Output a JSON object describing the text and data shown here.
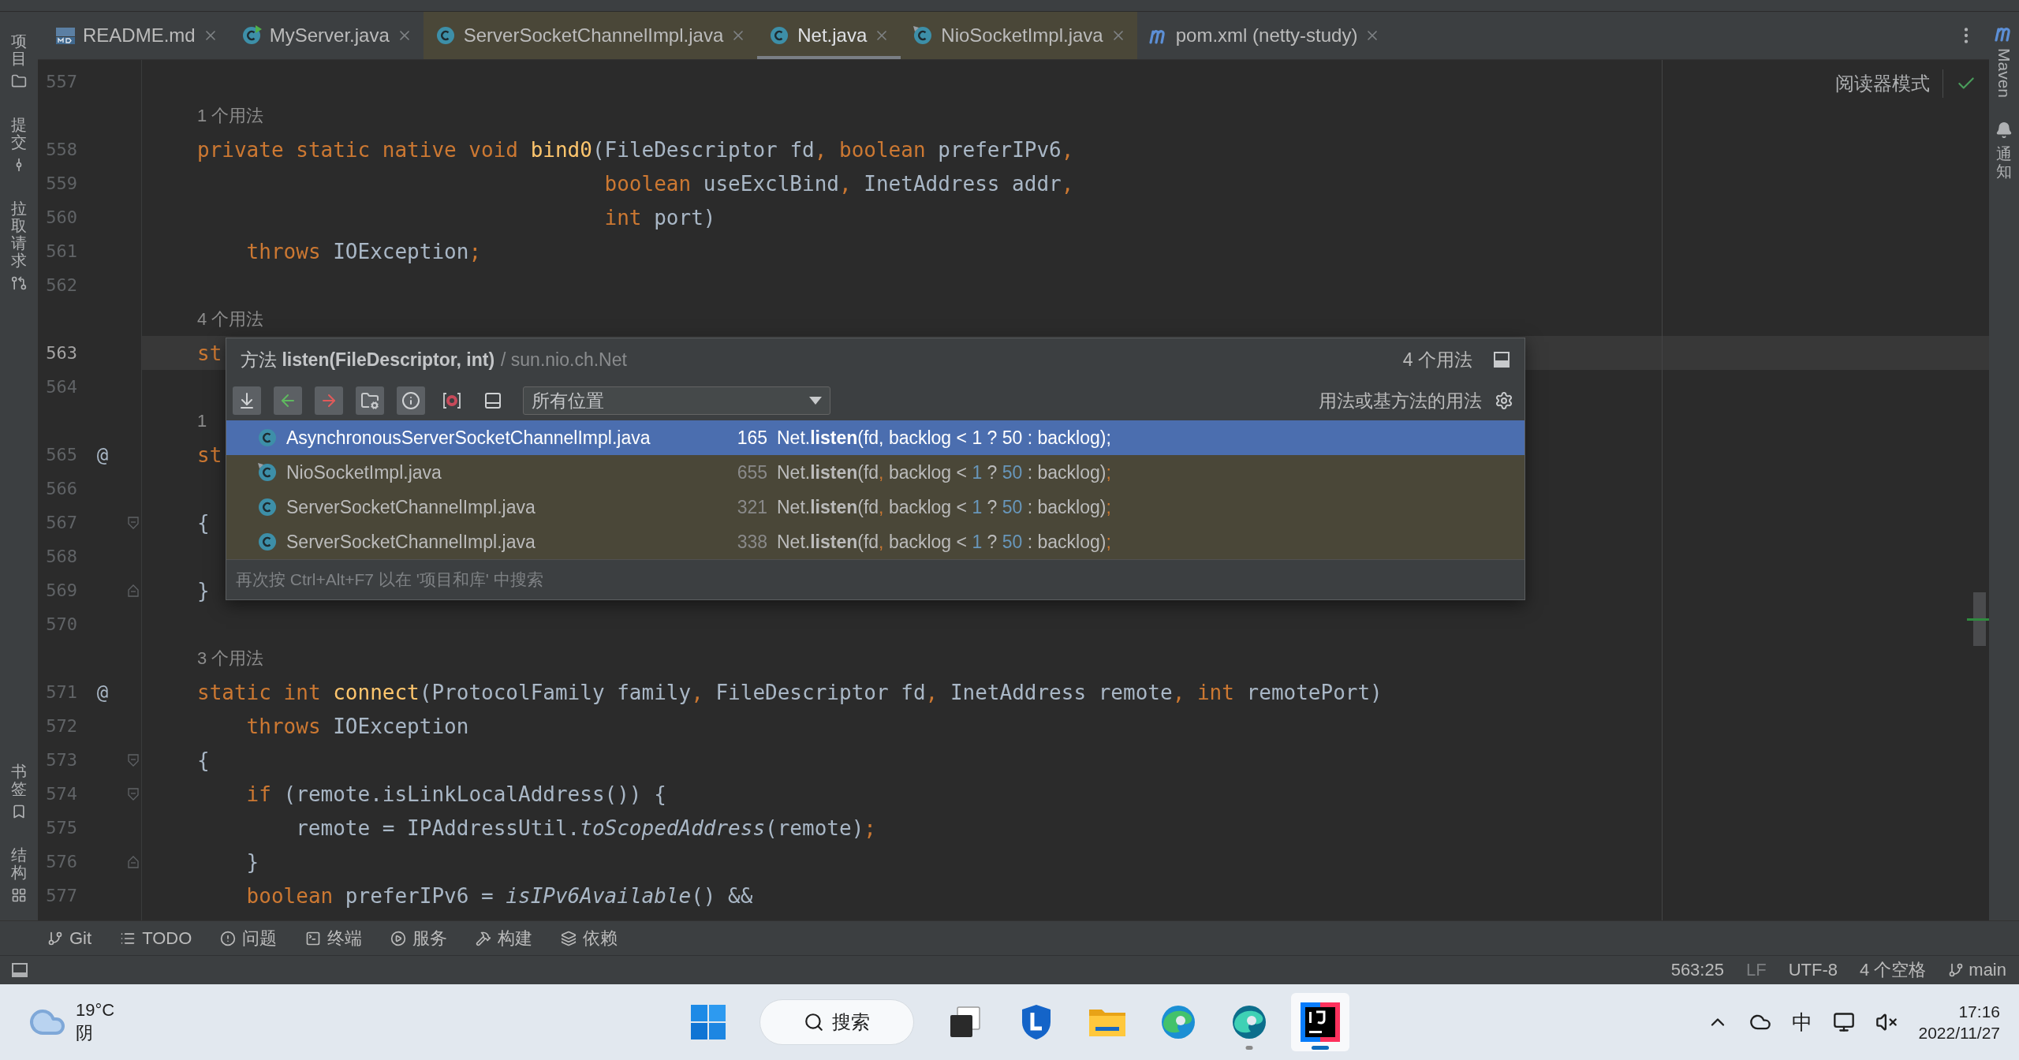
{
  "left_strip": {
    "top": [
      {
        "label": "项目",
        "kind": "folder"
      },
      {
        "label": "提交",
        "kind": "commit"
      },
      {
        "label": "拉取请求",
        "kind": "pull-request"
      }
    ],
    "bottom": [
      {
        "label": "书签",
        "kind": "bookmark"
      },
      {
        "label": "结构",
        "kind": "structure"
      }
    ]
  },
  "tabs": [
    {
      "label": "README.md",
      "kind": "markdown",
      "selected": false,
      "library": false
    },
    {
      "label": "MyServer.java",
      "kind": "class-run",
      "selected": false,
      "library": false
    },
    {
      "label": "ServerSocketChannelImpl.java",
      "kind": "class",
      "selected": false,
      "library": true
    },
    {
      "label": "Net.java",
      "kind": "class",
      "selected": true,
      "library": true
    },
    {
      "label": "NioSocketImpl.java",
      "kind": "class-pinned",
      "selected": false,
      "library": true
    },
    {
      "label": "pom.xml (netty-study)",
      "kind": "maven",
      "selected": false,
      "library": false
    }
  ],
  "editor": {
    "reader_mode": "阅读器模式",
    "lines": [
      {
        "kind": "code",
        "number": "557",
        "current": false
      },
      {
        "kind": "hint",
        "text": "1 个用法"
      },
      {
        "kind": "code",
        "number": "558",
        "current": false,
        "indent": {
          "kind": "none"
        },
        "tokens": [
          {
            "kind": "kw",
            "text": "private static native void "
          },
          {
            "kind": "method",
            "text": "bind0"
          },
          {
            "kind": "plain",
            "text": "(FileDescriptor fd"
          },
          {
            "kind": "punct",
            "text": ", "
          },
          {
            "kind": "kw",
            "text": "boolean "
          },
          {
            "kind": "plain",
            "text": "preferIPv6"
          },
          {
            "kind": "punct",
            "text": ","
          }
        ]
      },
      {
        "kind": "code",
        "number": "559",
        "current": false,
        "indent": {
          "kind": "args"
        },
        "tokens": [
          {
            "kind": "kw",
            "text": "boolean "
          },
          {
            "kind": "plain",
            "text": "useExclBind"
          },
          {
            "kind": "punct",
            "text": ", "
          },
          {
            "kind": "plain",
            "text": "InetAddress addr"
          },
          {
            "kind": "punct",
            "text": ","
          }
        ]
      },
      {
        "kind": "code",
        "number": "560",
        "current": false,
        "indent": {
          "kind": "args"
        },
        "tokens": [
          {
            "kind": "kw",
            "text": "int "
          },
          {
            "kind": "plain",
            "text": "port)"
          }
        ]
      },
      {
        "kind": "code",
        "number": "561",
        "current": false,
        "indent": {
          "kind": "one"
        },
        "tokens": [
          {
            "kind": "kw",
            "text": "throws "
          },
          {
            "kind": "plain",
            "text": "IOException"
          },
          {
            "kind": "punct",
            "text": ";"
          }
        ]
      },
      {
        "kind": "code",
        "number": "562",
        "current": false
      },
      {
        "kind": "hint",
        "text": "4 个用法"
      },
      {
        "kind": "code",
        "number": "563",
        "current": true,
        "indent": {
          "kind": "none"
        },
        "tokens": [
          {
            "kind": "kw",
            "text": "st"
          }
        ]
      },
      {
        "kind": "code",
        "number": "564",
        "current": false
      },
      {
        "kind": "hint",
        "text": "1"
      },
      {
        "kind": "code",
        "number": "565",
        "current": false,
        "marker": "@",
        "indent": {
          "kind": "none"
        },
        "tokens": [
          {
            "kind": "kw",
            "text": "st"
          }
        ]
      },
      {
        "kind": "code",
        "number": "566",
        "current": false
      },
      {
        "kind": "code",
        "number": "567",
        "current": false,
        "fold": {
          "kind": "start"
        },
        "indent": {
          "kind": "none"
        },
        "tokens": [
          {
            "kind": "plain",
            "text": "{"
          }
        ]
      },
      {
        "kind": "code",
        "number": "568",
        "current": false
      },
      {
        "kind": "code",
        "number": "569",
        "current": false,
        "fold": {
          "kind": "end"
        },
        "indent": {
          "kind": "none"
        },
        "tokens": [
          {
            "kind": "plain",
            "text": "}"
          }
        ]
      },
      {
        "kind": "code",
        "number": "570",
        "current": false
      },
      {
        "kind": "hint",
        "text": "3 个用法"
      },
      {
        "kind": "code",
        "number": "571",
        "current": false,
        "marker": "@",
        "indent": {
          "kind": "none"
        },
        "tokens": [
          {
            "kind": "kw",
            "text": "static int "
          },
          {
            "kind": "method",
            "text": "connect"
          },
          {
            "kind": "plain",
            "text": "(ProtocolFamily family"
          },
          {
            "kind": "punct",
            "text": ", "
          },
          {
            "kind": "plain",
            "text": "FileDescriptor fd"
          },
          {
            "kind": "punct",
            "text": ", "
          },
          {
            "kind": "plain",
            "text": "InetAddress remote"
          },
          {
            "kind": "punct",
            "text": ", "
          },
          {
            "kind": "kw",
            "text": "int "
          },
          {
            "kind": "plain",
            "text": "remotePort)"
          }
        ]
      },
      {
        "kind": "code",
        "number": "572",
        "current": false,
        "indent": {
          "kind": "one"
        },
        "tokens": [
          {
            "kind": "kw",
            "text": "throws "
          },
          {
            "kind": "plain",
            "text": "IOException"
          }
        ]
      },
      {
        "kind": "code",
        "number": "573",
        "current": false,
        "fold": {
          "kind": "start"
        },
        "indent": {
          "kind": "none"
        },
        "tokens": [
          {
            "kind": "plain",
            "text": "{"
          }
        ]
      },
      {
        "kind": "code",
        "number": "574",
        "current": false,
        "fold": {
          "kind": "start"
        },
        "indent": {
          "kind": "one"
        },
        "tokens": [
          {
            "kind": "kw",
            "text": "if "
          },
          {
            "kind": "plain",
            "text": "(remote.isLinkLocalAddress()) {"
          }
        ]
      },
      {
        "kind": "code",
        "number": "575",
        "current": false,
        "indent": {
          "kind": "two"
        },
        "tokens": [
          {
            "kind": "plain",
            "text": "remote = IPAddressUtil."
          },
          {
            "kind": "italic",
            "text": "toScopedAddress"
          },
          {
            "kind": "plain",
            "text": "(remote)"
          },
          {
            "kind": "punct",
            "text": ";"
          }
        ]
      },
      {
        "kind": "code",
        "number": "576",
        "current": false,
        "fold": {
          "kind": "end"
        },
        "indent": {
          "kind": "one"
        },
        "tokens": [
          {
            "kind": "plain",
            "text": "}"
          }
        ]
      },
      {
        "kind": "code",
        "number": "577",
        "current": false,
        "indent": {
          "kind": "one"
        },
        "tokens": [
          {
            "kind": "kw",
            "text": "boolean "
          },
          {
            "kind": "plain",
            "text": "preferIPv6 = "
          },
          {
            "kind": "italic",
            "text": "isIPv6Available"
          },
          {
            "kind": "plain",
            "text": "() &&"
          }
        ]
      }
    ]
  },
  "popup": {
    "title": "方法 **listen(FileDescriptor, int)**",
    "path": "/ sun.nio.ch.Net",
    "count": "4 个用法",
    "toolbar": [
      {
        "kind": "expand",
        "selected": true
      },
      {
        "kind": "previous",
        "selected": true
      },
      {
        "kind": "next",
        "selected": true
      },
      {
        "kind": "group-folder",
        "selected": true
      },
      {
        "kind": "info",
        "selected": true
      },
      {
        "kind": "module",
        "selected": false
      },
      {
        "kind": "preview",
        "selected": false
      }
    ],
    "scope": "所有位置",
    "filter_label": "用法或基方法的用法",
    "rows": [
      {
        "file": "AsynchronousServerSocketChannelImpl.java",
        "line": "165",
        "kind": "class",
        "selected": true,
        "snippet": [
          {
            "kind": "plain",
            "text": "Net."
          },
          {
            "kind": "bold",
            "text": "listen"
          },
          {
            "kind": "plain",
            "text": "(fd"
          },
          {
            "kind": "punct",
            "text": ","
          },
          {
            "kind": "plain",
            "text": " backlog < "
          },
          {
            "kind": "num",
            "text": "1"
          },
          {
            "kind": "plain",
            "text": " ? "
          },
          {
            "kind": "num",
            "text": "50"
          },
          {
            "kind": "plain",
            "text": " : backlog)"
          },
          {
            "kind": "punct",
            "text": ";"
          }
        ]
      },
      {
        "file": "NioSocketImpl.java",
        "line": "655",
        "kind": "class-pinned",
        "selected": false,
        "snippet": [
          {
            "kind": "plain",
            "text": "Net."
          },
          {
            "kind": "bold",
            "text": "listen"
          },
          {
            "kind": "plain",
            "text": "(fd"
          },
          {
            "kind": "punct",
            "text": ","
          },
          {
            "kind": "plain",
            "text": " backlog < "
          },
          {
            "kind": "num",
            "text": "1"
          },
          {
            "kind": "plain",
            "text": " ? "
          },
          {
            "kind": "num",
            "text": "50"
          },
          {
            "kind": "plain",
            "text": " : backlog)"
          },
          {
            "kind": "punct",
            "text": ";"
          }
        ]
      },
      {
        "file": "ServerSocketChannelImpl.java",
        "line": "321",
        "kind": "class",
        "selected": false,
        "snippet": [
          {
            "kind": "plain",
            "text": "Net."
          },
          {
            "kind": "bold",
            "text": "listen"
          },
          {
            "kind": "plain",
            "text": "(fd"
          },
          {
            "kind": "punct",
            "text": ","
          },
          {
            "kind": "plain",
            "text": " backlog < "
          },
          {
            "kind": "num",
            "text": "1"
          },
          {
            "kind": "plain",
            "text": " ? "
          },
          {
            "kind": "num",
            "text": "50"
          },
          {
            "kind": "plain",
            "text": " : backlog)"
          },
          {
            "kind": "punct",
            "text": ";"
          }
        ]
      },
      {
        "file": "ServerSocketChannelImpl.java",
        "line": "338",
        "kind": "class",
        "selected": false,
        "snippet": [
          {
            "kind": "plain",
            "text": "Net."
          },
          {
            "kind": "bold",
            "text": "listen"
          },
          {
            "kind": "plain",
            "text": "(fd"
          },
          {
            "kind": "punct",
            "text": ","
          },
          {
            "kind": "plain",
            "text": " backlog < "
          },
          {
            "kind": "num",
            "text": "1"
          },
          {
            "kind": "plain",
            "text": " ? "
          },
          {
            "kind": "num",
            "text": "50"
          },
          {
            "kind": "plain",
            "text": " : backlog)"
          },
          {
            "kind": "punct",
            "text": ";"
          }
        ]
      }
    ],
    "footer": "再次按 Ctrl+Alt+F7 以在 '项目和库' 中搜索"
  },
  "right_strip": {
    "maven": "Maven",
    "notifications": "通知"
  },
  "tool_windows": [
    {
      "label": "Git",
      "kind": "git"
    },
    {
      "label": "TODO",
      "kind": "list"
    },
    {
      "label": "问题",
      "kind": "problem"
    },
    {
      "label": "终端",
      "kind": "terminal"
    },
    {
      "label": "服务",
      "kind": "service"
    },
    {
      "label": "构建",
      "kind": "build"
    },
    {
      "label": "依赖",
      "kind": "dependencies"
    }
  ],
  "status_bar": {
    "position": "563:25",
    "line_separator": "LF",
    "encoding": "UTF-8",
    "indent": "4 个空格",
    "branch": "main"
  },
  "taskbar": {
    "weather": {
      "temperature": "19°C",
      "condition": "阴"
    },
    "search": "搜索",
    "apps": [
      {
        "kind": "start",
        "active": false,
        "running": false
      },
      {
        "kind": "search"
      },
      {
        "kind": "task-view",
        "active": false,
        "running": false
      },
      {
        "kind": "shield",
        "active": false,
        "running": false
      },
      {
        "kind": "explorer",
        "active": false,
        "running": false
      },
      {
        "kind": "browser",
        "active": false,
        "running": false
      },
      {
        "kind": "browser-dev",
        "active": false,
        "running": true
      },
      {
        "kind": "ide",
        "active": true,
        "running": true
      }
    ],
    "tray": {
      "input": "中",
      "time": "17:16",
      "date": "2022/11/27"
    }
  }
}
